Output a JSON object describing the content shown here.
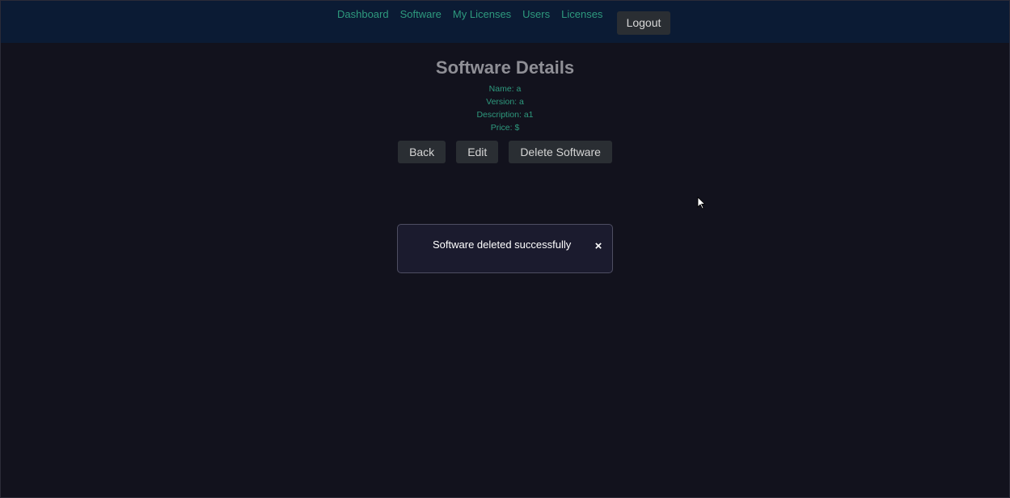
{
  "nav": {
    "links": [
      {
        "label": "Dashboard"
      },
      {
        "label": "Software"
      },
      {
        "label": "My Licenses"
      },
      {
        "label": "Users"
      },
      {
        "label": "Licenses"
      }
    ],
    "logout_label": "Logout"
  },
  "details": {
    "title": "Software Details",
    "name": "Name: a",
    "version": "Version: a",
    "description": "Description: a1",
    "price": "Price: $"
  },
  "actions": {
    "back_label": "Back",
    "edit_label": "Edit",
    "delete_label": "Delete Software"
  },
  "toast": {
    "message": "Software deleted successfully",
    "close_glyph": "×"
  },
  "colors": {
    "background": "#12121d",
    "navbar": "#0b1b34",
    "link": "#2e9a7e",
    "button": "#2a2e33",
    "toast_bg": "#1b1b2e"
  },
  "icons": {
    "close": "close-icon",
    "cursor": "mouse-pointer-icon"
  }
}
